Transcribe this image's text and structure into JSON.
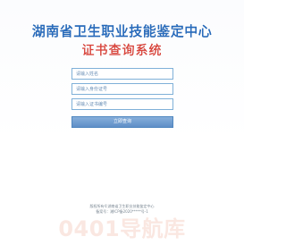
{
  "header": {
    "title": "湖南省卫生职业技能鉴定中心",
    "subtitle": "证书查询系统"
  },
  "form": {
    "name_placeholder": "请输入姓名",
    "id_placeholder": "请输入身份证号",
    "cert_placeholder": "请输入证书编号",
    "submit_label": "立即查询"
  },
  "footer": {
    "line1": "版权所有©湖南省卫生职业技能鉴定中心",
    "line2": "备案号：湘ICP备2020*****号-1"
  },
  "watermark": {
    "text": "0401导航库"
  },
  "colors": {
    "title": "#2a70c7",
    "subtitle": "#e0453a",
    "input_border": "#7fb0d8",
    "button": "#6f9bd0"
  }
}
